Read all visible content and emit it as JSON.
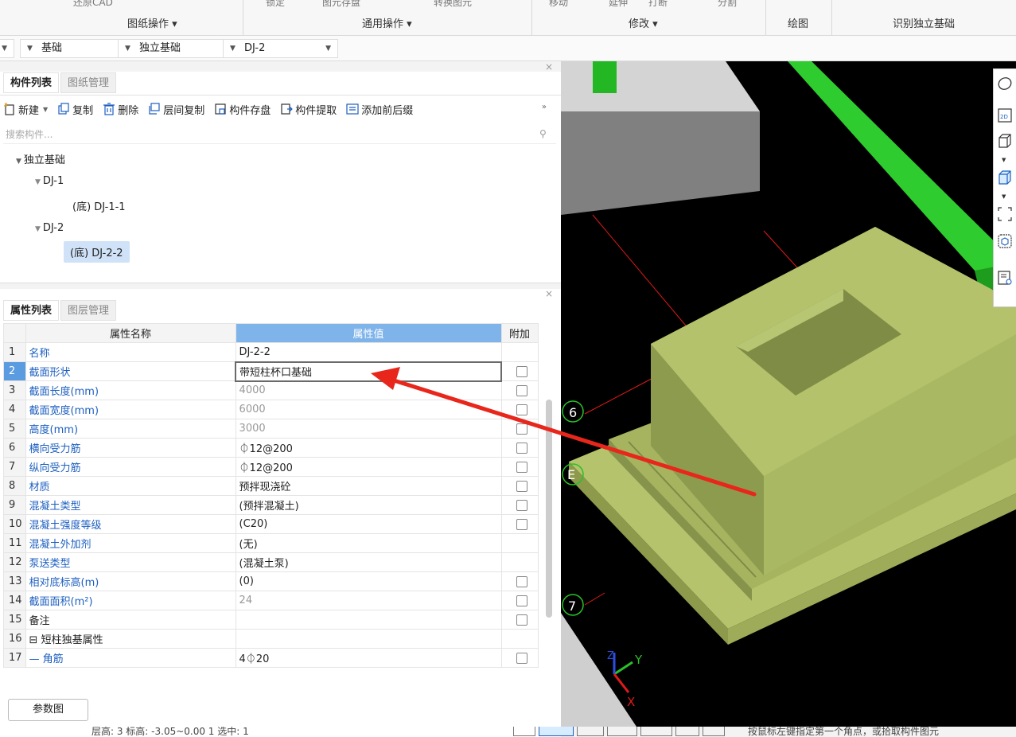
{
  "ribbon": {
    "cut_labels": [
      "还原CAD",
      "锁定",
      "图元存盘",
      "转换图元",
      "移动",
      "延伸",
      "打断",
      "分割"
    ],
    "groups": [
      {
        "label": "图纸操作 ▾"
      },
      {
        "label": "通用操作 ▾"
      },
      {
        "label": "修改 ▾"
      },
      {
        "label": "绘图"
      },
      {
        "label": "识别独立基础"
      }
    ]
  },
  "selectors": {
    "floor": "",
    "category": "基础",
    "type": "独立基础",
    "component": "DJ-2"
  },
  "component_panel": {
    "tabs": [
      {
        "label": "构件列表",
        "active": true
      },
      {
        "label": "图纸管理",
        "active": false
      }
    ],
    "toolbar": [
      {
        "label": "新建",
        "icon": "new-icon"
      },
      {
        "label": "复制",
        "icon": "copy-icon"
      },
      {
        "label": "删除",
        "icon": "delete-icon"
      },
      {
        "label": "层间复制",
        "icon": "floor-copy-icon"
      },
      {
        "label": "构件存盘",
        "icon": "save-component-icon"
      },
      {
        "label": "构件提取",
        "icon": "extract-icon"
      },
      {
        "label": "添加前后缀",
        "icon": "prefix-icon"
      }
    ],
    "more": "»",
    "search_placeholder": "搜索构件...",
    "tree": {
      "root": "独立基础",
      "n1": "DJ-1",
      "n1c": "(底) DJ-1-1",
      "n2": "DJ-2",
      "n2c": "(底) DJ-2-2"
    }
  },
  "property_panel": {
    "tabs": [
      {
        "label": "属性列表",
        "active": true
      },
      {
        "label": "图层管理",
        "active": false
      }
    ],
    "headers": {
      "name": "属性名称",
      "value": "属性值",
      "extra": "附加"
    },
    "rows": [
      {
        "n": "1",
        "name": "名称",
        "value": "DJ-2-2",
        "cb": false,
        "gray": false
      },
      {
        "n": "2",
        "name": "截面形状",
        "value": "带短柱杯口基础",
        "cb": true,
        "gray": false
      },
      {
        "n": "3",
        "name": "截面长度(mm)",
        "value": "4000",
        "cb": true,
        "gray": true
      },
      {
        "n": "4",
        "name": "截面宽度(mm)",
        "value": "6000",
        "cb": true,
        "gray": true
      },
      {
        "n": "5",
        "name": "高度(mm)",
        "value": "3000",
        "cb": true,
        "gray": true
      },
      {
        "n": "6",
        "name": "横向受力筋",
        "value": "⏀12@200",
        "cb": true,
        "gray": false
      },
      {
        "n": "7",
        "name": "纵向受力筋",
        "value": "⏀12@200",
        "cb": true,
        "gray": false
      },
      {
        "n": "8",
        "name": "材质",
        "value": "预拌现浇砼",
        "cb": true,
        "gray": false
      },
      {
        "n": "9",
        "name": "混凝土类型",
        "value": "(预拌混凝土)",
        "cb": true,
        "gray": false
      },
      {
        "n": "10",
        "name": "混凝土强度等级",
        "value": "(C20)",
        "cb": true,
        "gray": false
      },
      {
        "n": "11",
        "name": "混凝土外加剂",
        "value": "(无)",
        "cb": false,
        "gray": false
      },
      {
        "n": "12",
        "name": "泵送类型",
        "value": "(混凝土泵)",
        "cb": false,
        "gray": false
      },
      {
        "n": "13",
        "name": "相对底标高(m)",
        "value": "(0)",
        "cb": true,
        "gray": false
      },
      {
        "n": "14",
        "name": "截面面积(m²)",
        "value": "24",
        "cb": true,
        "gray": true
      },
      {
        "n": "15",
        "name": "备注",
        "value": "",
        "cb": true,
        "gray": false
      },
      {
        "n": "16",
        "name": "⊟ 短柱独基属性",
        "value": "",
        "cb": false,
        "gray": false
      },
      {
        "n": "17",
        "name": "— 角筋",
        "value": "4⏀20",
        "cb": true,
        "gray": false
      }
    ],
    "param_button": "参数图"
  },
  "status": {
    "text": "层高: 3    标高: -3.05~0.00    1    选中: 1",
    "hint": "按鼠标左键指定第一个角点，或拾取构件图元"
  },
  "viewport": {
    "axis_labels": [
      "6",
      "E",
      "7"
    ],
    "axes": {
      "x": "X",
      "y": "Y",
      "z": "Z"
    }
  },
  "colors": {
    "accent": "#5b9be0",
    "foundation": "#a9b863",
    "beam": "#25c225",
    "arrow": "#e8261c"
  }
}
